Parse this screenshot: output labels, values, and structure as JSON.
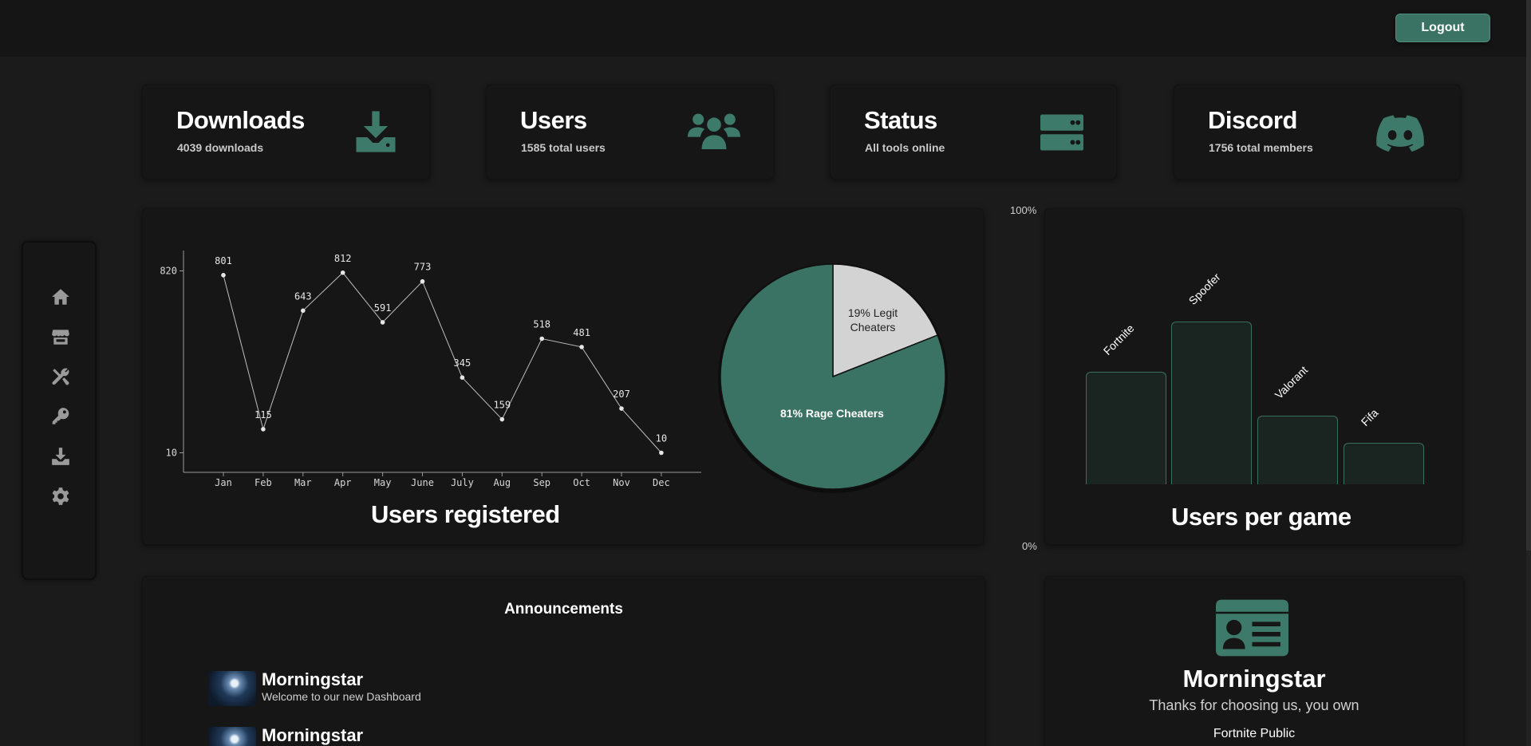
{
  "header": {
    "logout_label": "Logout"
  },
  "sidebar": {
    "items": [
      {
        "icon": "home-icon"
      },
      {
        "icon": "store-icon"
      },
      {
        "icon": "tools-icon"
      },
      {
        "icon": "key-icon"
      },
      {
        "icon": "download-icon"
      },
      {
        "icon": "gear-icon"
      }
    ]
  },
  "stats": [
    {
      "title": "Downloads",
      "sub": "4039 downloads",
      "icon": "download-icon"
    },
    {
      "title": "Users",
      "sub": "1585 total users",
      "icon": "users-icon"
    },
    {
      "title": "Status",
      "sub": "All tools online",
      "icon": "server-icon"
    },
    {
      "title": "Discord",
      "sub": "1756 total members",
      "icon": "discord-icon"
    }
  ],
  "colors": {
    "accent": "#3a7363",
    "background": "#1b1b1b",
    "card": "#161616",
    "pie_light": "#d3d3d3"
  },
  "chart_data": [
    {
      "type": "line",
      "title": "Users registered",
      "categories": [
        "Jan",
        "Feb",
        "Mar",
        "Apr",
        "May",
        "June",
        "July",
        "Aug",
        "Sep",
        "Oct",
        "Nov",
        "Dec"
      ],
      "values": [
        801,
        115,
        643,
        812,
        591,
        773,
        345,
        159,
        518,
        481,
        207,
        10
      ],
      "yticks": [
        10,
        820
      ],
      "ylim": [
        10,
        820
      ]
    },
    {
      "type": "pie",
      "slices": [
        {
          "label_line1": "19% Legit",
          "label_line2": "Cheaters",
          "value": 19,
          "color": "#d3d3d3"
        },
        {
          "label_line1": "81% Rage Cheaters",
          "value": 81,
          "color": "#3a7363"
        }
      ]
    },
    {
      "type": "bar",
      "title": "Users per game",
      "categories": [
        "Fortnite",
        "Spoofer",
        "Valorant",
        "Fifa"
      ],
      "values": [
        41,
        59,
        25,
        15
      ],
      "y_max_label": "100%",
      "y_min_label": "0%",
      "ylim": [
        0,
        100
      ]
    }
  ],
  "announcements": {
    "title": "Announcements",
    "items": [
      {
        "author": "Morningstar",
        "message": "Welcome to our new Dashboard"
      },
      {
        "author": "Morningstar",
        "message": ""
      }
    ]
  },
  "profile": {
    "name": "Morningstar",
    "thanks": "Thanks for choosing us, you own",
    "product": "Fortnite Public"
  }
}
